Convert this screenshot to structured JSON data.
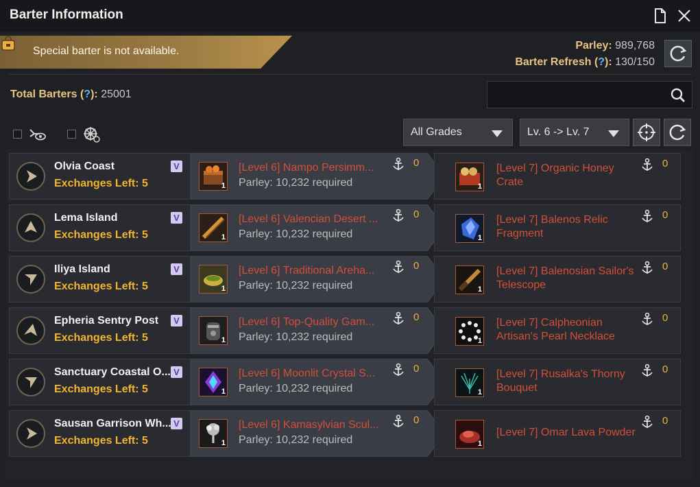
{
  "window": {
    "title": "Barter Information",
    "doc_icon": "document-icon",
    "close_icon": "close-icon"
  },
  "special_barter": {
    "text": "Special barter is not available.",
    "icon": "bag-icon"
  },
  "parley": {
    "label": "Parley",
    "value": "989,768"
  },
  "barter_refresh": {
    "label": "Barter Refresh",
    "help": "?",
    "value": "130/150"
  },
  "total_barters": {
    "label": "Total Barters",
    "help": "?",
    "value": "25001"
  },
  "search": {
    "placeholder": ""
  },
  "filters": {
    "grade": "All Grades",
    "level": "Lv. 6 -> Lv. 7"
  },
  "colors": {
    "accent_gold": "#f2b530",
    "item_red": "#d24f3a",
    "help_blue": "#5fb2ff"
  },
  "rows": [
    {
      "location": "Olvia Coast",
      "exchanges_label": "Exchanges Left",
      "exchanges": "5",
      "badge": "V",
      "give_item": "[Level 6] Nampo Persimm...",
      "give_qty": "1",
      "parley_req": "Parley: 10,232 required",
      "give_count": "0",
      "get_item_line1": "[Level 7] Organic Honey",
      "get_item_line2": "Crate",
      "get_qty": "1",
      "get_count": "0",
      "direction": "right"
    },
    {
      "location": "Lema Island",
      "exchanges_label": "Exchanges Left",
      "exchanges": "5",
      "badge": "V",
      "give_item": "[Level 6] Valencian Desert ...",
      "give_qty": "1",
      "parley_req": "Parley: 10,232 required",
      "give_count": "0",
      "get_item_line1": "[Level 7] Balenos Relic",
      "get_item_line2": "Fragment",
      "get_qty": "1",
      "get_count": "0",
      "direction": "up"
    },
    {
      "location": "Iliya Island",
      "exchanges_label": "Exchanges Left",
      "exchanges": "5",
      "badge": "V",
      "give_item": "[Level 6] Traditional Areha...",
      "give_qty": "1",
      "parley_req": "Parley: 10,232 required",
      "give_count": "0",
      "get_item_line1": "[Level 7] Balenosian Sailor's",
      "get_item_line2": "Telescope",
      "get_qty": "1",
      "get_count": "0",
      "direction": "down-left"
    },
    {
      "location": "Epheria Sentry Post",
      "exchanges_label": "Exchanges Left",
      "exchanges": "5",
      "badge": "V",
      "give_item": "[Level 6] Top-Quality Gam...",
      "give_qty": "1",
      "parley_req": "Parley: 10,232 required",
      "give_count": "0",
      "get_item_line1": "[Level 7] Calpheonian",
      "get_item_line2": "Artisan's Pearl Necklace",
      "get_qty": "1",
      "get_count": "0",
      "direction": "up-left"
    },
    {
      "location": "Sanctuary Coastal O...",
      "exchanges_label": "Exchanges Left",
      "exchanges": "5",
      "badge": "V",
      "give_item": "[Level 6] Moonlit Crystal S...",
      "give_qty": "1",
      "parley_req": "Parley: 10,232 required",
      "give_count": "0",
      "get_item_line1": "[Level 7] Rusalka's Thorny",
      "get_item_line2": "Bouquet",
      "get_qty": "1",
      "get_count": "0",
      "direction": "down-left"
    },
    {
      "location": "Sausan Garrison Wh...",
      "exchanges_label": "Exchanges Left",
      "exchanges": "5",
      "badge": "V",
      "give_item": "[Level 6] Kamasylvian Scul...",
      "give_qty": "1",
      "parley_req": "Parley: 10,232 required",
      "give_count": "0",
      "get_item_line1": "[Level 7] Omar Lava Powder",
      "get_item_line2": "",
      "get_qty": "1",
      "get_count": "0",
      "direction": "right"
    }
  ]
}
